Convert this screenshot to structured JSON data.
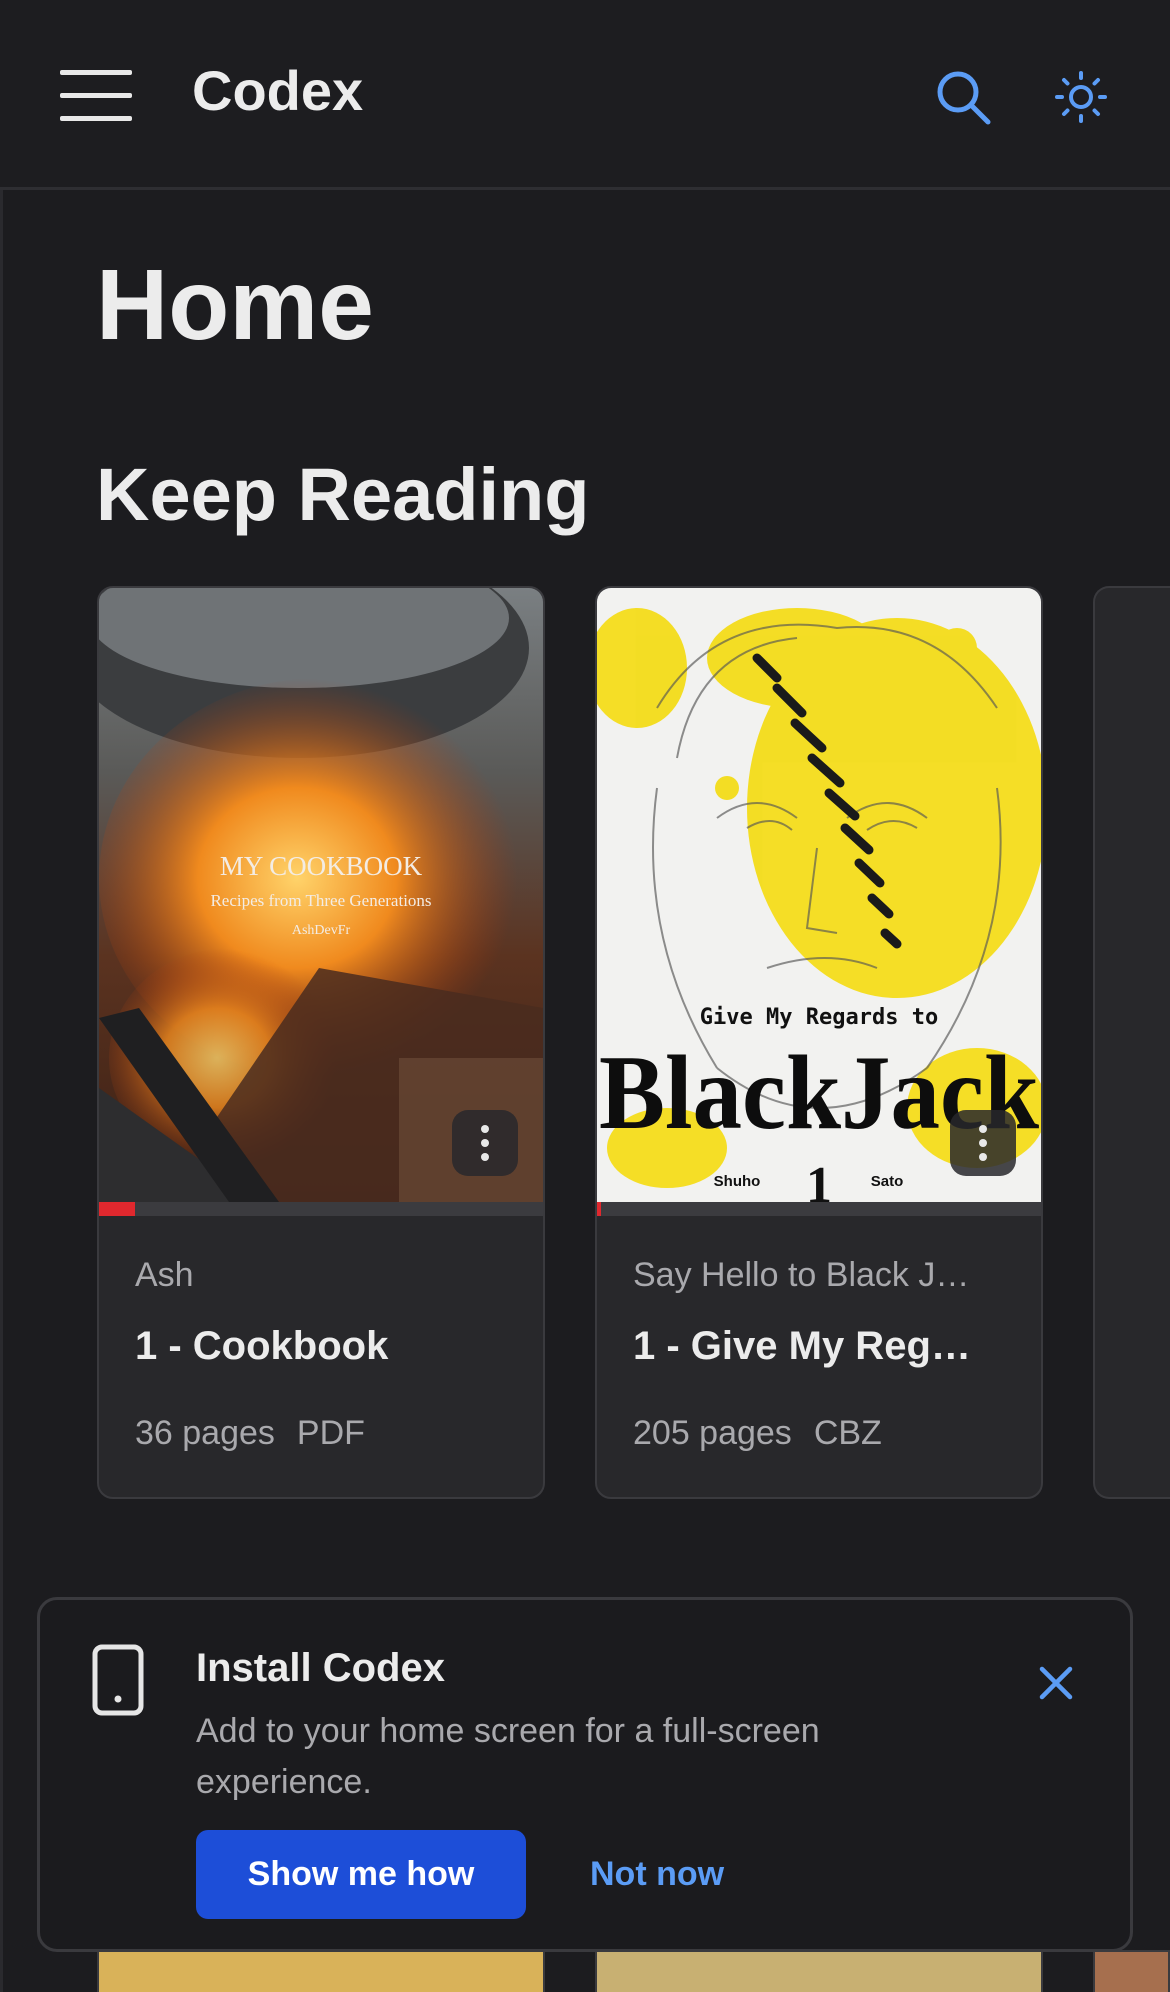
{
  "app": {
    "title": "Codex"
  },
  "header": {
    "menu_icon": "hamburger-menu-icon",
    "search_icon": "search-icon",
    "theme_icon": "sun-icon",
    "accent_color": "#5b9cf5"
  },
  "page": {
    "title": "Home"
  },
  "keep_reading": {
    "title": "Keep Reading",
    "books": [
      {
        "cover_text": {
          "title": "MY COOKBOOK",
          "subtitle": "Recipes from Three Generations",
          "author": "AshDevFr"
        },
        "series": "Ash",
        "title": "1 - Cookbook",
        "pages": "36 pages",
        "format": "PDF",
        "progress": 0.08
      },
      {
        "cover_text": {
          "top": "Give My Regards to",
          "title": "BlackJack",
          "number": "1",
          "author_left": "Shuho",
          "author_right": "Sato"
        },
        "series": "Say Hello to Black J…",
        "title": "1 - Give My Reg…",
        "pages": "205 pages",
        "format": "CBZ",
        "progress": 0.01
      }
    ]
  },
  "install_banner": {
    "icon": "smartphone-icon",
    "title": "Install Codex",
    "description": "Add to your home screen for a full-screen experience.",
    "primary_button": "Show me how",
    "secondary_button": "Not now",
    "close_icon": "close-icon",
    "primary_color": "#1d4ed8",
    "progress_color": "#e0282e"
  }
}
